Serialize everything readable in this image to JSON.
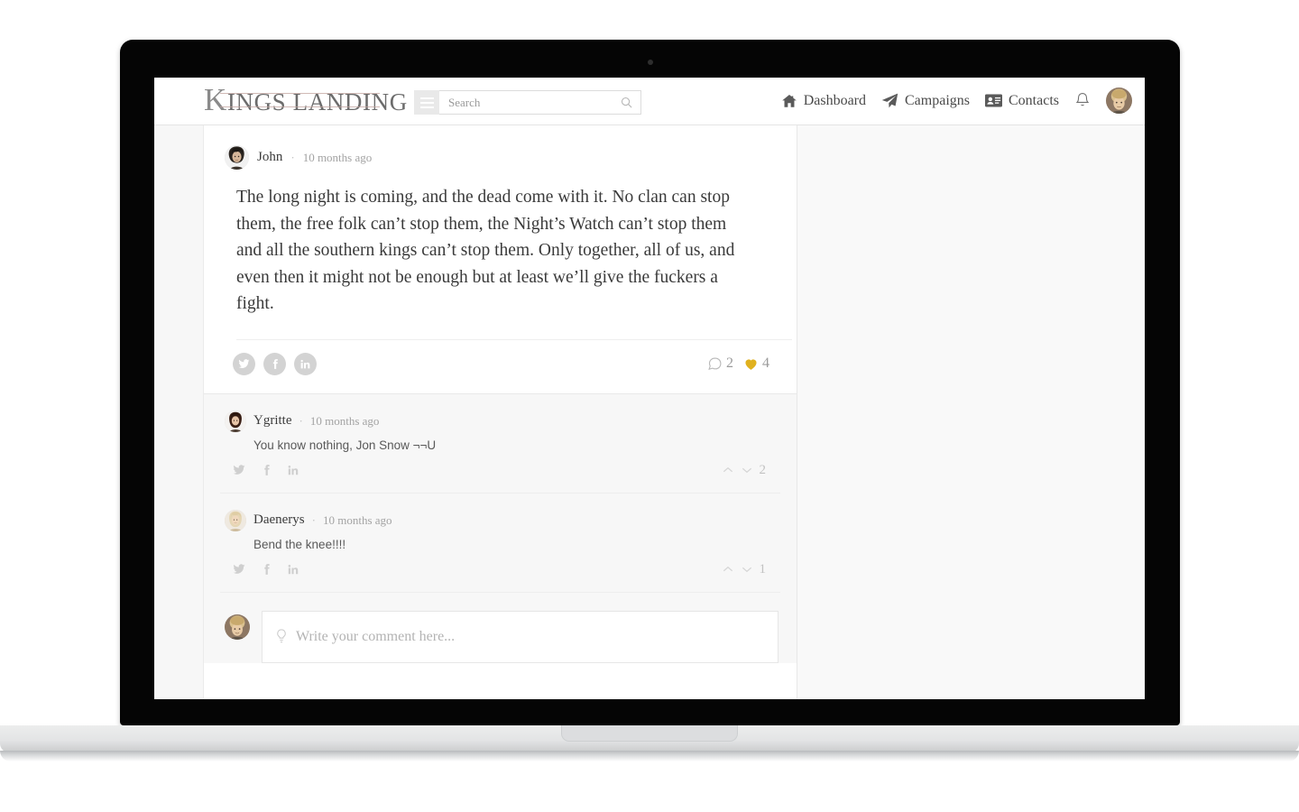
{
  "brand": {
    "name_cap": "K",
    "name_rest": "INGS LANDING"
  },
  "search": {
    "placeholder": "Search",
    "value": "",
    "icon": "search-icon",
    "menu_icon": "hamburger-menu-icon"
  },
  "nav": {
    "items": [
      {
        "label": "Dashboard",
        "icon": "home-icon"
      },
      {
        "label": "Campaigns",
        "icon": "paper-plane-icon"
      },
      {
        "label": "Contacts",
        "icon": "contact-card-icon"
      }
    ],
    "bell_icon": "bell-icon",
    "avatar_icon": "user-avatar"
  },
  "post": {
    "author": "John",
    "separator": "·",
    "time": "10 months ago",
    "body": "The long night is coming, and the dead come with it. No clan can stop them, the free folk can’t stop them, the Night’s Watch can’t stop them and all the southern kings can’t stop them. Only together, all of us, and even then it might not be enough but at least we’ll give the fuckers a fight.",
    "share": [
      {
        "name": "twitter-share-button",
        "icon": "twitter-icon"
      },
      {
        "name": "facebook-share-button",
        "icon": "facebook-icon"
      },
      {
        "name": "linkedin-share-button",
        "icon": "linkedin-icon"
      }
    ],
    "comment_count": "2",
    "like_count": "4",
    "like_color": "#e0b11f"
  },
  "comments": [
    {
      "author": "Ygritte",
      "separator": "·",
      "time": "10 months ago",
      "text": "You know nothing, Jon Snow ¬¬U",
      "vote_count": "2"
    },
    {
      "author": "Daenerys",
      "separator": "·",
      "time": "10 months ago",
      "text": "Bend the knee!!!!",
      "vote_count": "1"
    }
  ],
  "composer": {
    "placeholder": "Write your comment here...",
    "value": "",
    "icon": "lightbulb-icon"
  }
}
